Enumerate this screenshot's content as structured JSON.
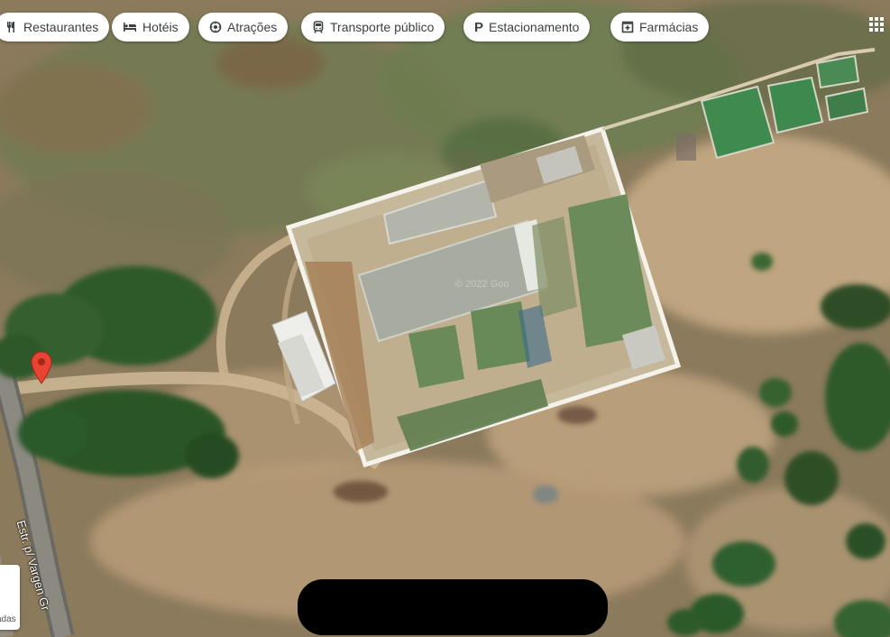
{
  "categories": [
    {
      "label": "Restaurantes",
      "icon": "restaurant-icon"
    },
    {
      "label": "Hotéis",
      "icon": "hotel-icon"
    },
    {
      "label": "Atrações",
      "icon": "attractions-icon"
    },
    {
      "label": "Transporte público",
      "icon": "transit-icon"
    },
    {
      "label": "Estacionamento",
      "icon": "parking-icon"
    },
    {
      "label": "Farmácias",
      "icon": "pharmacy-icon"
    }
  ],
  "map": {
    "street_label": "Estr. p/ Vargen Gr",
    "watermark": "© 2022 Goo",
    "corner_tab_text": "adas",
    "marker_color": "#ea4335"
  },
  "apps_icon": "apps-grid-icon"
}
